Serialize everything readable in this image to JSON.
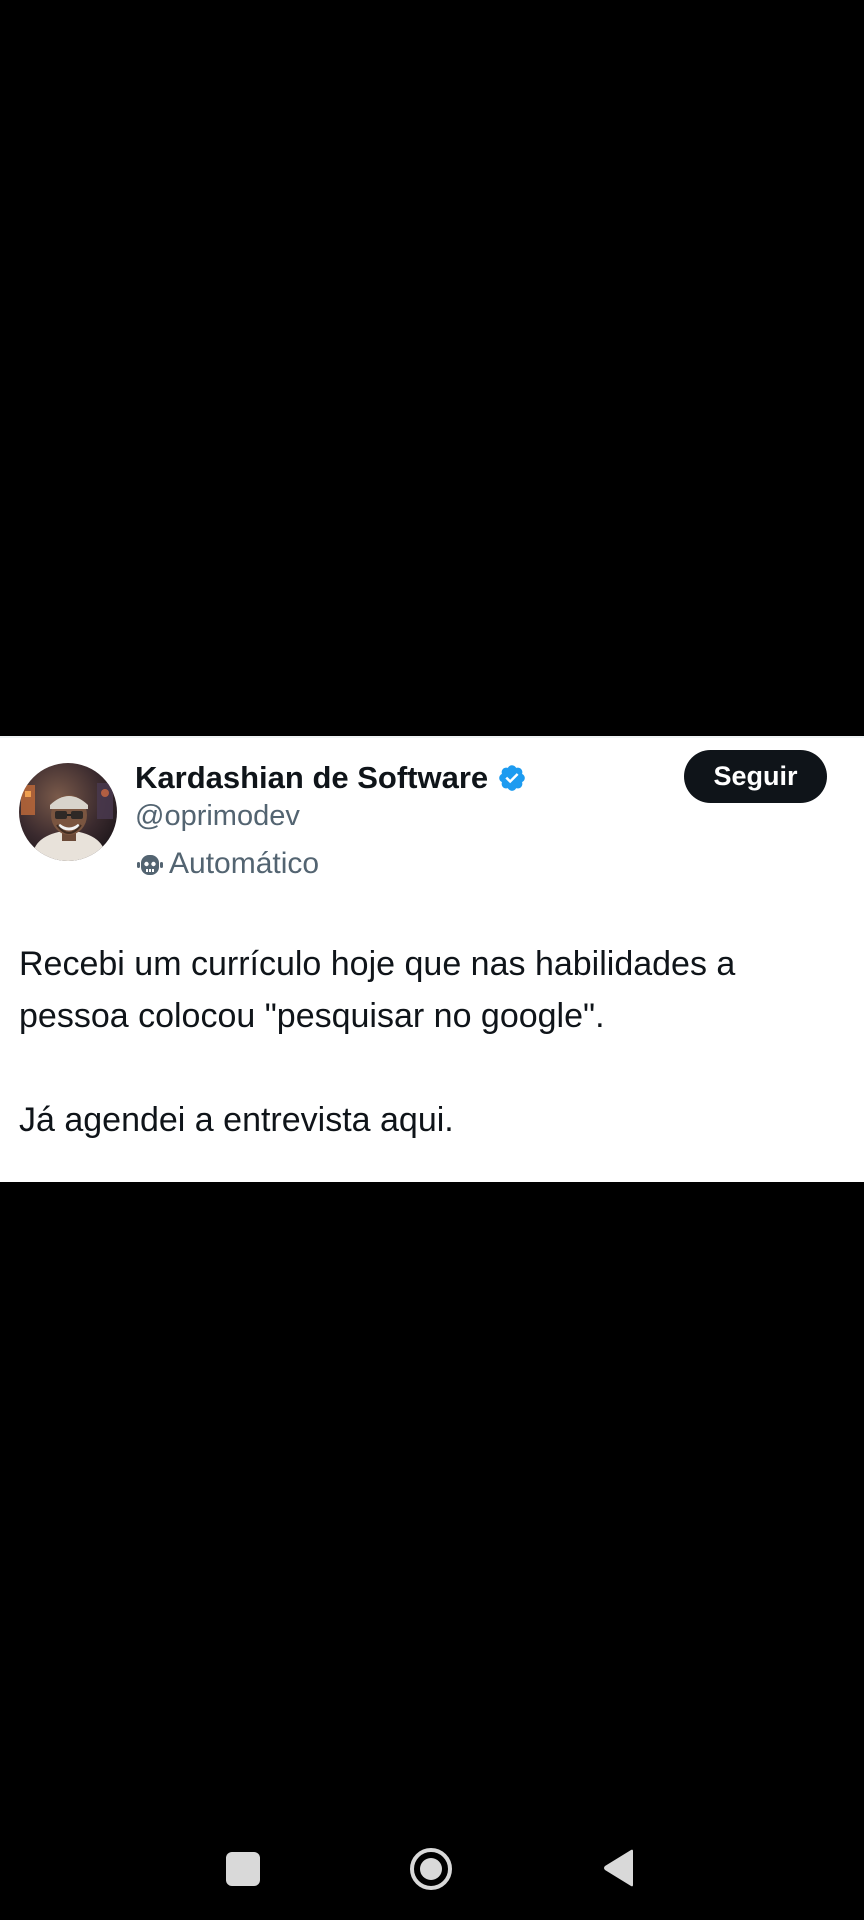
{
  "tweet": {
    "author_name": "Kardashian de Software",
    "handle": "@oprimodev",
    "automated_label": "Automático",
    "follow_label": "Seguir",
    "text_paragraphs": [
      "Recebi um currículo hoje que nas habilidades a pessoa colocou \"pesquisar no google\".",
      "Já agendei a entrevista aqui."
    ],
    "verified": true
  },
  "icons": {
    "verified": "verified-badge-icon",
    "automated": "bot-icon",
    "nav_recents": "square-icon",
    "nav_home": "circle-home-icon",
    "nav_back": "triangle-back-icon"
  },
  "colors": {
    "background": "#000000",
    "card": "#ffffff",
    "primary_text": "#0f1419",
    "secondary_text": "#536471",
    "verified_blue": "#1d9bf0",
    "follow_button": "#0f1419",
    "nav_icons": "#d9d9d9"
  }
}
